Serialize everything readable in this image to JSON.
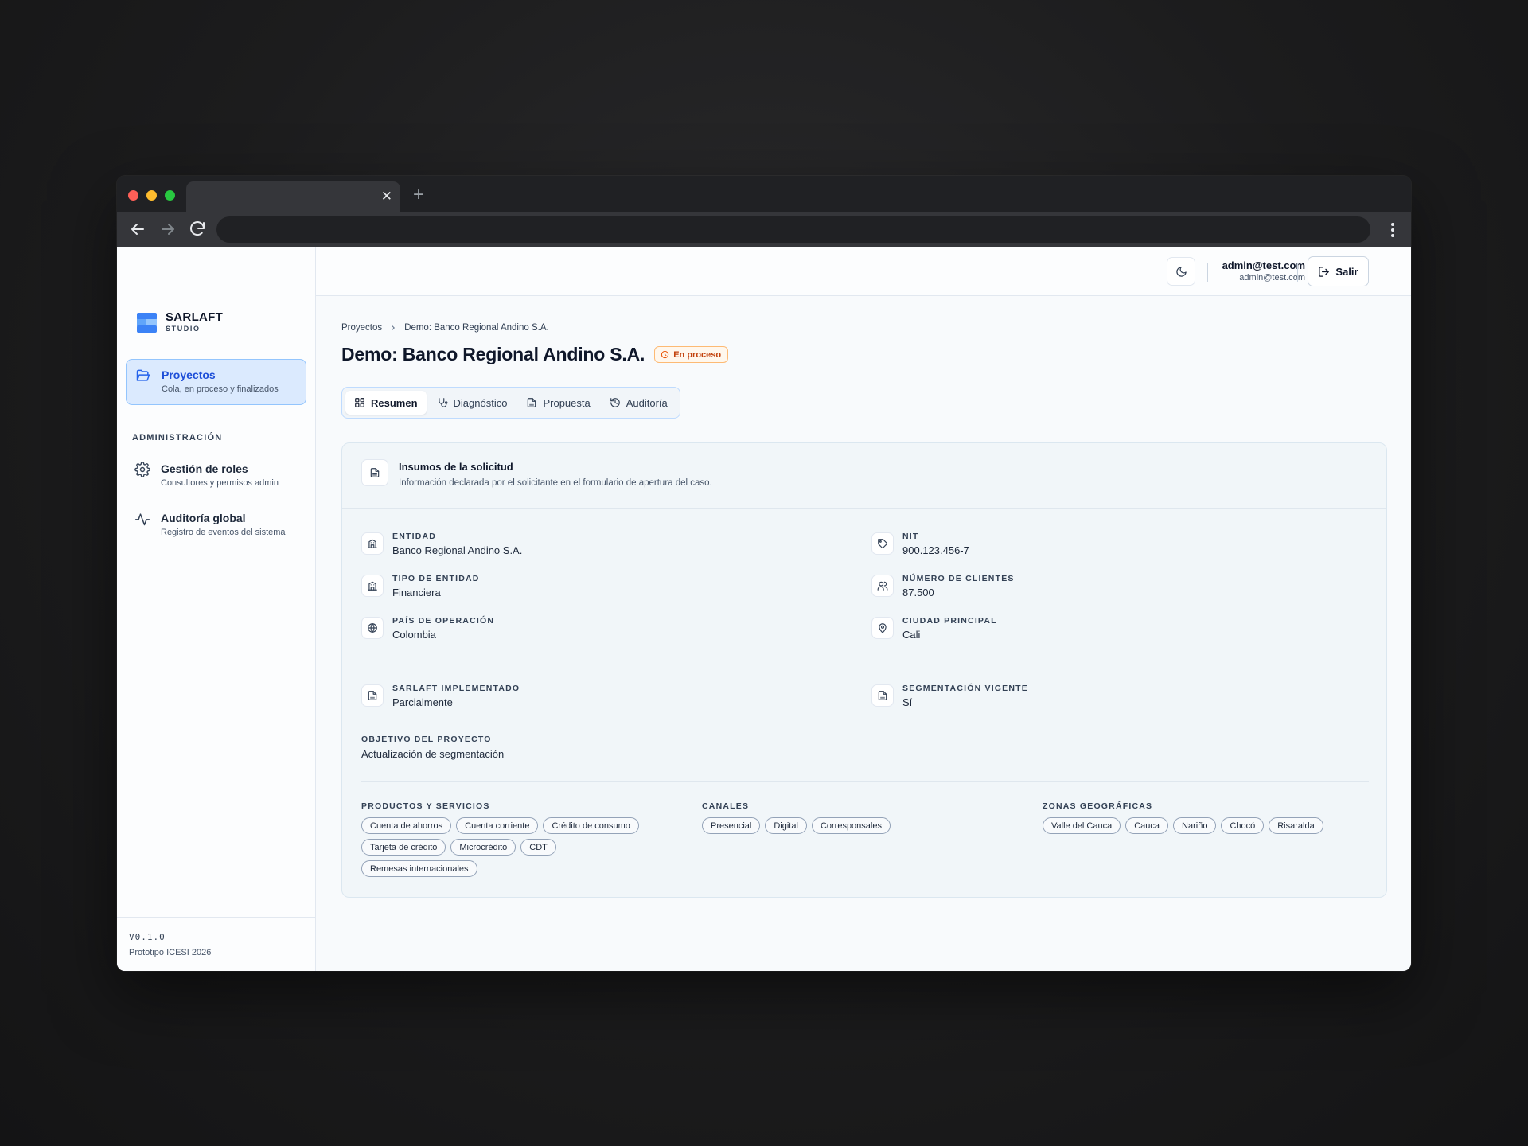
{
  "sidebar": {
    "brand_title": "SARLAFT",
    "brand_sub": "STUDIO",
    "nav_primary": {
      "label": "Proyectos",
      "desc": "Cola, en proceso y finalizados"
    },
    "section_label": "ADMINISTRACIÓN",
    "nav_roles": {
      "label": "Gestión de roles",
      "desc": "Consultores y permisos admin"
    },
    "nav_audit": {
      "label": "Auditoría global",
      "desc": "Registro de eventos del sistema"
    },
    "version": "V0.1.0",
    "footer_note": "Prototipo ICESI 2026"
  },
  "header": {
    "user_name": "admin@test.com",
    "user_email": "admin@test.com",
    "logout_label": "Salir"
  },
  "breadcrumb": {
    "root": "Proyectos",
    "current": "Demo: Banco Regional Andino S.A."
  },
  "page": {
    "title": "Demo: Banco Regional Andino S.A.",
    "status": "En proceso"
  },
  "tabs": [
    "Resumen",
    "Diagnóstico",
    "Propuesta",
    "Auditoría"
  ],
  "card": {
    "title": "Insumos de la solicitud",
    "description": "Información declarada por el solicitante en el formulario de apertura del caso.",
    "fields": {
      "entidad": {
        "label": "Entidad",
        "value": "Banco Regional Andino S.A."
      },
      "nit": {
        "label": "NIT",
        "value": "900.123.456-7"
      },
      "tipo": {
        "label": "Tipo de entidad",
        "value": "Financiera"
      },
      "clientes": {
        "label": "Número de clientes",
        "value": "87.500"
      },
      "pais": {
        "label": "País de operación",
        "value": "Colombia"
      },
      "ciudad": {
        "label": "Ciudad principal",
        "value": "Cali"
      },
      "sarlaft": {
        "label": "SARLAFT implementado",
        "value": "Parcialmente"
      },
      "segmentacion": {
        "label": "Segmentación vigente",
        "value": "Sí"
      }
    },
    "objetivo": {
      "label": "OBJETIVO DEL PROYECTO",
      "value": "Actualización de segmentación"
    },
    "productos": {
      "label": "PRODUCTOS Y SERVICIOS",
      "items": [
        "Cuenta de ahorros",
        "Cuenta corriente",
        "Crédito de consumo",
        "Tarjeta de crédito",
        "Microcrédito",
        "CDT",
        "Remesas internacionales"
      ]
    },
    "canales": {
      "label": "CANALES",
      "items": [
        "Presencial",
        "Digital",
        "Corresponsales"
      ]
    },
    "zonas": {
      "label": "ZONAS GEOGRÁFICAS",
      "items": [
        "Valle del Cauca",
        "Cauca",
        "Nariño",
        "Chocó",
        "Risaralda"
      ]
    }
  },
  "colors": {
    "accent": "#2563eb",
    "status": "#c2410c",
    "logo": "#3b82f6"
  }
}
